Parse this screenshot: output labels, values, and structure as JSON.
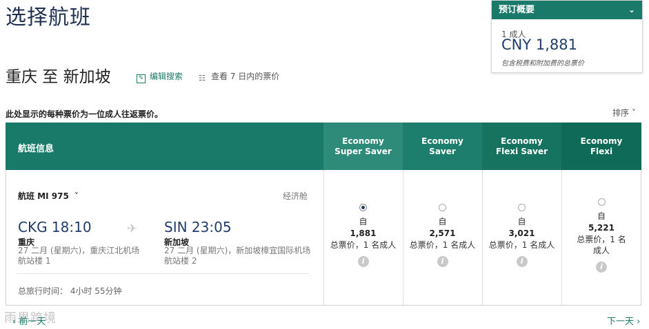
{
  "page_title": "选择航班",
  "summary": {
    "header": "预订概要",
    "pax": "1 成人",
    "price": "CNY 1,881",
    "note": "包含税费和附加费的总票价"
  },
  "route": {
    "title": "重庆 至 新加坡",
    "edit_label": "编辑搜索",
    "week_label": "查看 7 日内的票价"
  },
  "price_note": "此处显示的每种票价为一位成人往返票价。",
  "sort_label": "排序",
  "table": {
    "info_header": "航班信息",
    "columns": [
      {
        "line1": "Economy",
        "line2": "Super Saver"
      },
      {
        "line1": "Economy",
        "line2": "Saver"
      },
      {
        "line1": "Economy",
        "line2": "Flexi Saver"
      },
      {
        "line1": "Economy",
        "line2": "Flexi"
      }
    ]
  },
  "flight": {
    "number": "航班 MI 975",
    "cabin": "经济舱",
    "dep_time": "CKG 18:10",
    "dep_city": "重庆",
    "dep_detail": "27 二月 (星期六)，重庆江北机场",
    "dep_terminal": "航站楼 1",
    "arr_time": "SIN 23:05",
    "arr_city": "新加坡",
    "arr_detail": "27 二月 (星期六)，新加坡樟宜国际机场",
    "arr_terminal": "航站楼 2",
    "total_time": "总旅行时间： 4小时 55分钟"
  },
  "fares": [
    {
      "from": "自",
      "amount": "1,881",
      "desc": "总票价，1 名成人",
      "selected": true
    },
    {
      "from": "自",
      "amount": "2,571",
      "desc": "总票价，1 名成人",
      "selected": false
    },
    {
      "from": "自",
      "amount": "3,021",
      "desc": "总票价，1 名成人",
      "selected": false
    },
    {
      "from": "自",
      "amount": "5,221",
      "desc": "总票价，1 名成人",
      "selected": false
    }
  ],
  "nav": {
    "prev": "前一天",
    "next": "下一天"
  },
  "watermark": "雨果跨境",
  "colors": {
    "accent": "#1a7a6a",
    "price_text": "#1f3c6b"
  }
}
